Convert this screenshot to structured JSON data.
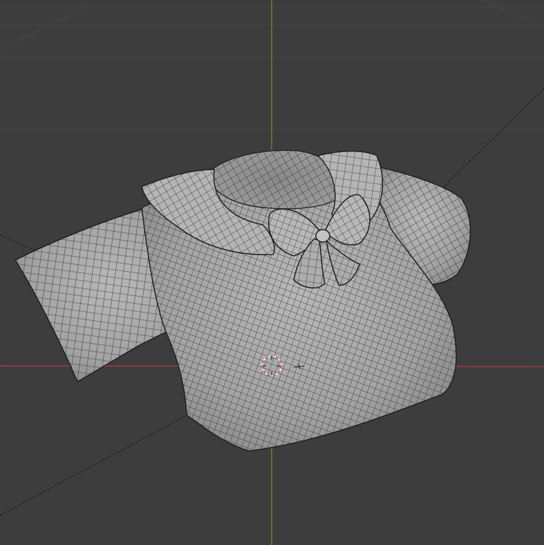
{
  "viewport": {
    "background": "#3d3d3d",
    "grid_color": "#484848",
    "x_axis_color": "#b3414b",
    "y_axis_color": "#6e9a2a",
    "mesh_fill": "#a8a8a8",
    "mesh_wire": "#2a2a2a",
    "cursor_color": "#d94a4a"
  },
  "scene": {
    "object": "blouse-mesh",
    "shading": "solid-wireframe",
    "view": "perspective"
  },
  "icons": {
    "cursor": "3d-cursor-icon",
    "light": "light-object-icon"
  }
}
